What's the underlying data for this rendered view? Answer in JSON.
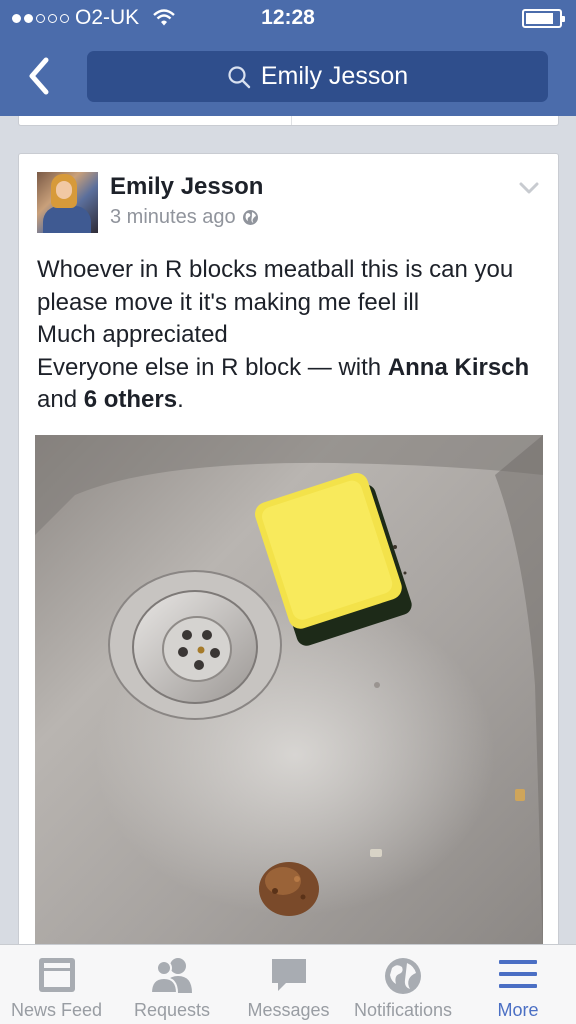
{
  "status_bar": {
    "carrier": "O2-UK",
    "time": "12:28",
    "signal_bars": 2,
    "signal_total": 5,
    "battery_level": 0.85
  },
  "nav": {
    "back_icon": "chevron-left-icon",
    "search_icon": "search-icon",
    "search_value": "Emily Jesson"
  },
  "post": {
    "author": "Emily Jesson",
    "timestamp": "3 minutes ago",
    "privacy_icon": "globe-icon",
    "text": {
      "line1": "Whoever in R blocks meatball this is can you please move it it's making me feel ill",
      "line2": "Much appreciated",
      "line3_prefix": "Everyone else in R block — with ",
      "tag_person": "Anna Kirsch",
      "tag_and": " and ",
      "tag_others": "6 others",
      "tag_end": "."
    }
  },
  "tabbar": {
    "tabs": [
      {
        "label": "News Feed",
        "icon": "news-feed-icon"
      },
      {
        "label": "Requests",
        "icon": "requests-icon"
      },
      {
        "label": "Messages",
        "icon": "messages-icon"
      },
      {
        "label": "Notifications",
        "icon": "globe-notifications-icon"
      },
      {
        "label": "More",
        "icon": "menu-icon",
        "active": true
      }
    ]
  },
  "colors": {
    "header": "#4b6cab",
    "search_field": "#2f4e8c",
    "active_tab": "#4b6fc4",
    "inactive_tab": "#999da3"
  }
}
